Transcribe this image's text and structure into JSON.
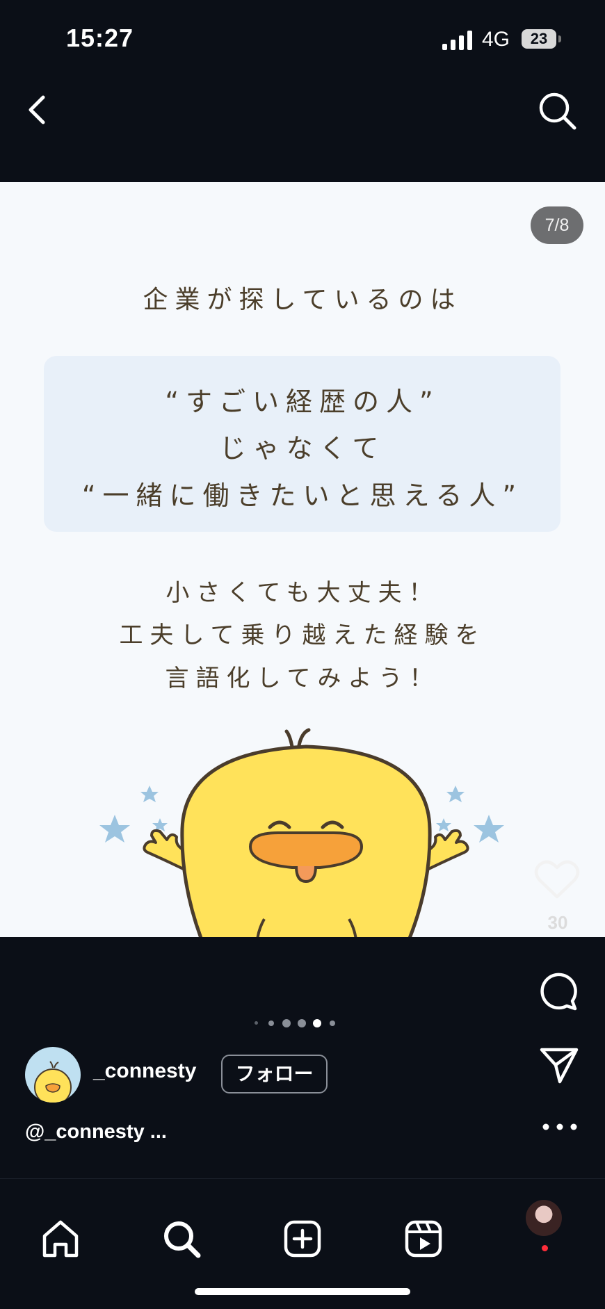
{
  "status_bar": {
    "time": "15:27",
    "network": "4G",
    "battery": "23",
    "icons": [
      "signal-icon",
      "battery-icon"
    ]
  },
  "nav": {
    "icons": [
      "back-icon",
      "search-icon"
    ]
  },
  "post": {
    "page_counter": "7/8",
    "heading": "企業が探しているのは",
    "quote_lines": [
      "“すごい経歴の人”",
      "じゃなくて",
      "“一緒に働きたいと思える人”"
    ],
    "body_lines": [
      "小さくても大丈夫！",
      "工夫して乗り越えた経験を",
      "言語化してみよう！"
    ],
    "colors": {
      "background": "#f6f9fc",
      "quote_box": "#e8f0f9",
      "text": "#4b3e2a",
      "mascot_body": "#ffe25a",
      "mascot_beak": "#f6a13a",
      "stars": "#9cc4e0"
    }
  },
  "actions": {
    "like_count": "30",
    "icons": [
      "heart-icon",
      "comment-icon",
      "share-icon",
      "more-icon"
    ]
  },
  "carousel": {
    "total": 8,
    "active_index": 6
  },
  "author": {
    "username": "_connesty",
    "follow_label": "フォロー",
    "caption": "@_connesty ..."
  },
  "tab_bar": {
    "icons": [
      "home-icon",
      "explore-icon",
      "create-icon",
      "reels-icon",
      "profile-avatar"
    ]
  }
}
